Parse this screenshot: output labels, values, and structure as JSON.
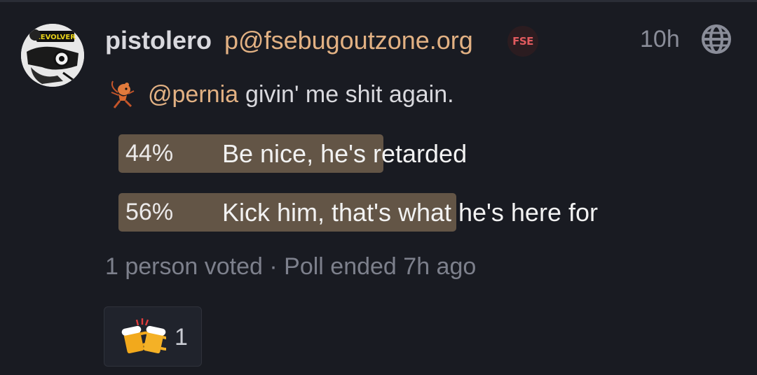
{
  "post": {
    "avatar_text": "REVOLVER",
    "display_name": "pistolero",
    "handle": "p@fsebugoutzone.org",
    "instance_badge": "FSE",
    "time": "10h",
    "visibility_icon": "globe-icon",
    "content_emoji_icon": "running-rat-emoji-icon",
    "mention": "@pernia",
    "text": "givin' me shit again."
  },
  "poll": {
    "options": [
      {
        "percent": "44%",
        "label": "Be nice, he's retarded",
        "fraction": 0.44
      },
      {
        "percent": "56%",
        "label": "Kick him, that's what he's here for",
        "fraction": 0.56
      }
    ],
    "meta": "1 person voted · Poll ended 7h ago"
  },
  "reaction": {
    "icon": "beer-mugs-icon",
    "count": "1"
  },
  "colors": {
    "background": "#191b22",
    "accent": "#e2b183",
    "poll_bar": "#635546",
    "badge": "#e05a5e"
  }
}
